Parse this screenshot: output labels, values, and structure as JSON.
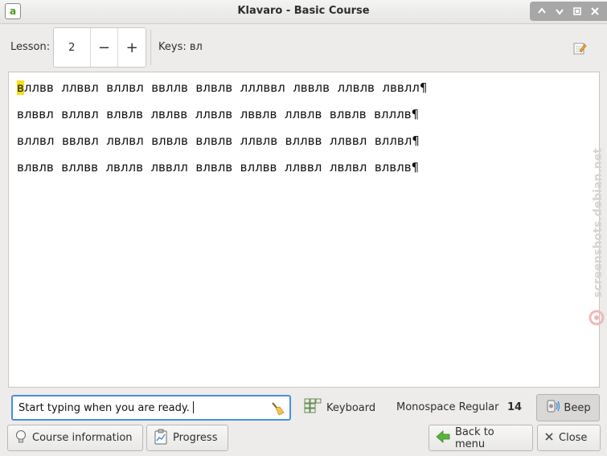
{
  "window": {
    "title": "Klavaro - Basic Course",
    "app_icon_letter": "a",
    "controls": [
      "up-icon",
      "down-icon",
      "maximize-icon",
      "close-icon"
    ]
  },
  "toolbar": {
    "lesson_label": "Lesson:",
    "lesson_value": "2",
    "decrement": "−",
    "increment": "+",
    "keys_label": "Keys: вл"
  },
  "exercise": {
    "lines": [
      {
        "first": "в",
        "rest": "ллвв  ллввл  вллвл  ввллв  влвлв  лллввл  лввлв  ллвлв  лввлл¶"
      },
      {
        "rest": "влввл  вллвл  влвлв  лвлвв  ллвлв  лввлв  ллвлв  влвлв  влллв¶"
      },
      {
        "rest": "вллвл  ввлвл  лвлвл  влвлв  влвлв  ллвлв  вллвв  ллввл  вллвл¶"
      },
      {
        "rest": "влвлв  вллвв  лвллв  лввлл  влвлв  вллвв  ллввл  лвлвл  влвлв¶"
      }
    ]
  },
  "bottom": {
    "entry_text": "Start typing when you are ready.",
    "keyboard_label": "Keyboard",
    "font_name": "Monospace Regular",
    "font_size": "14",
    "beep_label": "Beep",
    "course_info_label": "Course information",
    "progress_label": "Progress",
    "back_label": "Back to menu",
    "close_label": "Close"
  },
  "watermark": "screenshots.debian.net",
  "colors": {
    "accent": "#4a90d9",
    "cursor_highlight": "#f4e01c"
  }
}
